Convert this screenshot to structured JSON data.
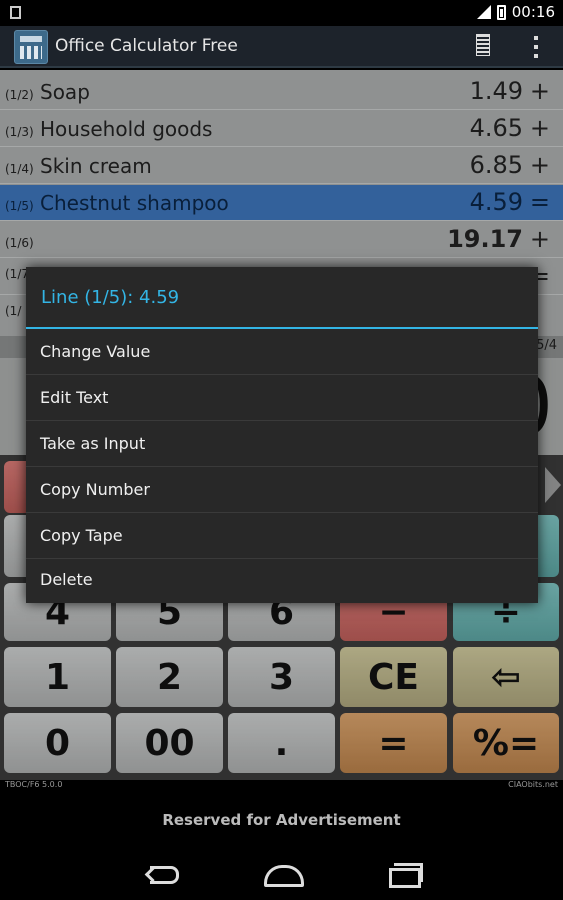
{
  "status": {
    "time": "00:16"
  },
  "app": {
    "title": "Office Calculator Free"
  },
  "tape": {
    "rows": [
      {
        "idx": "(1/2)",
        "text": "Soap",
        "value": "1.49",
        "op": "+"
      },
      {
        "idx": "(1/3)",
        "text": "Household goods",
        "value": "4.65",
        "op": "+"
      },
      {
        "idx": "(1/4)",
        "text": "Skin cream",
        "value": "6.85",
        "op": "+"
      },
      {
        "idx": "(1/5)",
        "text": "Chestnut shampoo",
        "value": "4.59",
        "op": "="
      },
      {
        "idx": "(1/6)",
        "text": "",
        "value": "19.17",
        "op": "+"
      },
      {
        "idx": "(1/7",
        "text": "",
        "value": "",
        "op": "="
      },
      {
        "idx": "(1/",
        "text": "",
        "value": "",
        "op": ""
      }
    ],
    "side_count": "5/4"
  },
  "display": {
    "value": "0"
  },
  "keypad": {
    "row3": [
      "4",
      "5",
      "6",
      "−",
      "÷"
    ],
    "row4": [
      "1",
      "2",
      "3",
      "CE",
      "⇦"
    ],
    "row5": [
      "0",
      "00",
      ".",
      "=",
      "%="
    ]
  },
  "footer": {
    "version": "TBOC/F6 5.0.0",
    "brand": "CIAObits.net"
  },
  "ad": {
    "text": "Reserved for Advertisement"
  },
  "dialog": {
    "title": "Line (1/5): 4.59",
    "items": [
      "Change Value",
      "Edit Text",
      "Take as Input",
      "Copy Number",
      "Copy Tape",
      "Delete"
    ]
  }
}
